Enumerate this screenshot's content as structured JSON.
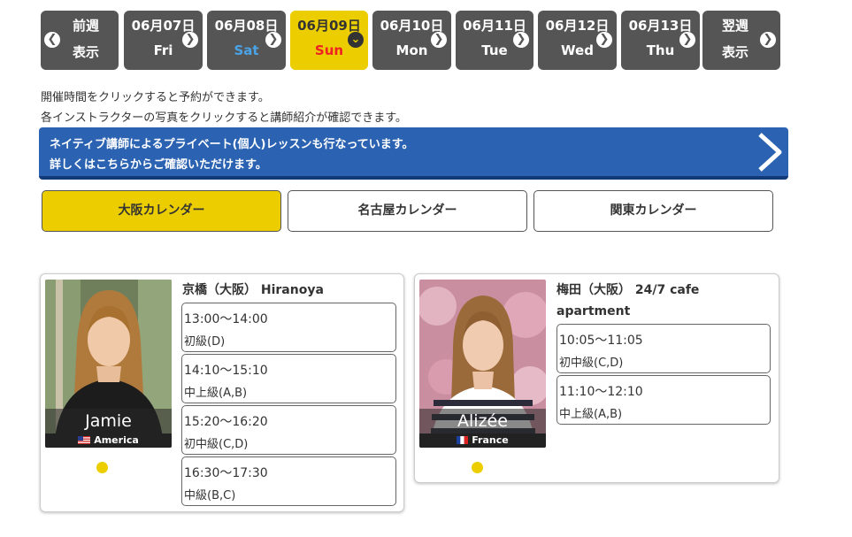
{
  "date_nav": {
    "prev": {
      "line1": "前週",
      "line2": "表示"
    },
    "days": [
      {
        "date": "06月07日",
        "dow": "Fri"
      },
      {
        "date": "06月08日",
        "dow": "Sat"
      },
      {
        "date": "06月09日",
        "dow": "Sun"
      },
      {
        "date": "06月10日",
        "dow": "Mon"
      },
      {
        "date": "06月11日",
        "dow": "Tue"
      },
      {
        "date": "06月12日",
        "dow": "Wed"
      },
      {
        "date": "06月13日",
        "dow": "Thu"
      }
    ],
    "next": {
      "line1": "翌週",
      "line2": "表示"
    },
    "selected": "06月09日"
  },
  "notices": [
    "開催時間をクリックすると予約ができます。",
    "各インストラクターの写真をクリックすると講師紹介が確認できます。"
  ],
  "banner": {
    "line1": "ネイティブ講師によるプライベート(個人)レッスンも行なっています。",
    "line2": "詳しくはこちらからご確認いただけます。"
  },
  "regions": [
    {
      "label": "大阪カレンダー",
      "active": true
    },
    {
      "label": "名古屋カレンダー",
      "active": false
    },
    {
      "label": "関東カレンダー",
      "active": false
    }
  ],
  "instructors": [
    {
      "name": "Jamie",
      "country": "America",
      "location_line1": "京橋（大阪） Hiranoya",
      "location_line2": "",
      "slots": [
        {
          "time": "13:00〜14:00",
          "level": "初級(D)"
        },
        {
          "time": "14:10〜15:10",
          "level": "中上級(A,B)"
        },
        {
          "time": "15:20〜16:20",
          "level": "初中級(C,D)"
        },
        {
          "time": "16:30〜17:30",
          "level": "中級(B,C)"
        }
      ]
    },
    {
      "name": "Alizée",
      "country": "France",
      "location_line1": "梅田（大阪） 24/7 cafe",
      "location_line2": "apartment",
      "slots": [
        {
          "time": "10:05〜11:05",
          "level": "初中級(C,D)"
        },
        {
          "time": "11:10〜12:10",
          "level": "中上級(A,B)"
        }
      ]
    }
  ],
  "colors": {
    "accent": "#ecce00",
    "tab": "#555555",
    "banner": "#2b63b2",
    "sat": "#4aa3e6",
    "sun": "#e22222"
  }
}
